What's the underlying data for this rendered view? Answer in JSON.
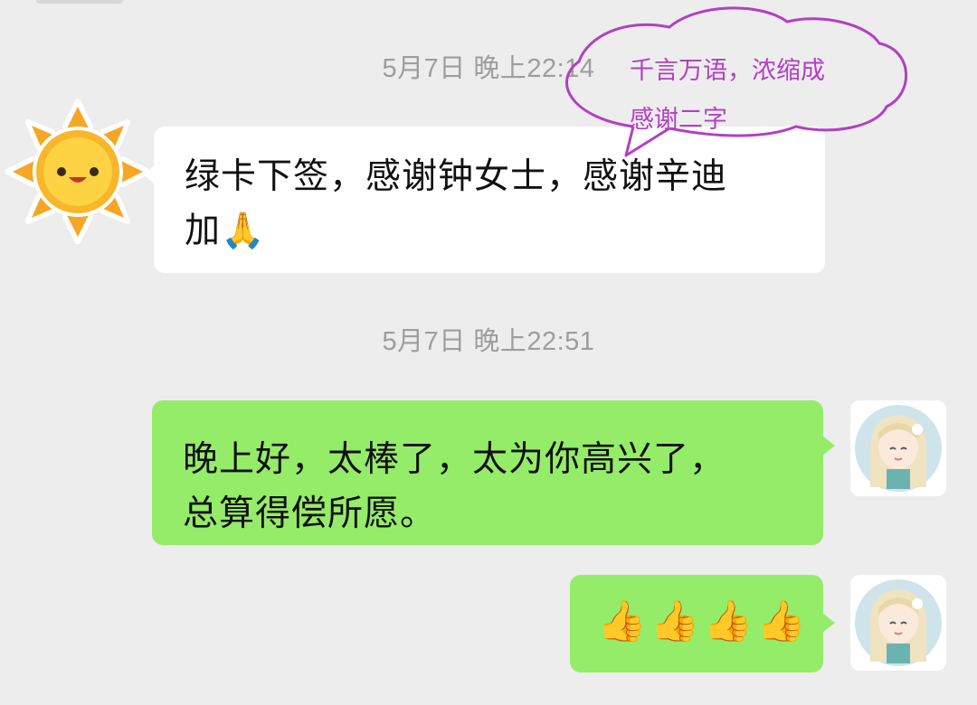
{
  "timestamps": [
    "5月7日 晚上22:14",
    "5月7日 晚上22:51"
  ],
  "messages": [
    {
      "side": "left",
      "text_line1": "绿卡下签，感谢钟女士，感谢辛迪",
      "text_line2": "加🙏"
    },
    {
      "side": "right",
      "text_line1": "晚上好，太棒了，太为你高兴了，",
      "text_line2": "总算得偿所愿。"
    },
    {
      "side": "right",
      "text": "👍👍👍👍"
    }
  ],
  "annotation": {
    "line1": "千言万语，浓缩成",
    "line2": "感谢二字",
    "color": "#b33fc4"
  },
  "avatars": {
    "contact": "sun-icon",
    "self": "girl-avatar"
  },
  "colors": {
    "background": "#ededed",
    "incoming_bubble": "#ffffff",
    "outgoing_bubble": "#95ec69"
  }
}
